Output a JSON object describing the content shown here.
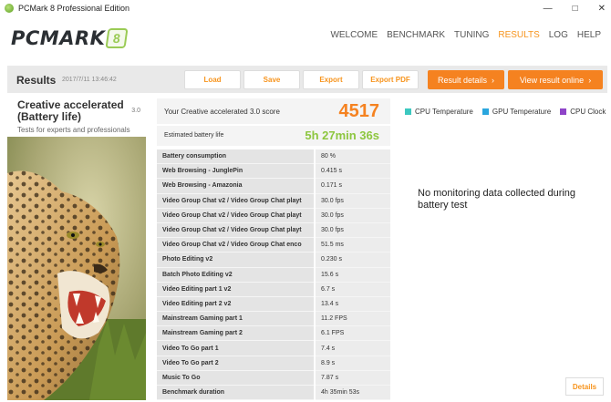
{
  "window": {
    "title": "PCMark 8 Professional Edition",
    "controls": [
      "—",
      "□",
      "✕"
    ]
  },
  "logo": {
    "text": "PCMARK",
    "badge": "8"
  },
  "nav": [
    {
      "label": "WELCOME",
      "active": false
    },
    {
      "label": "BENCHMARK",
      "active": false
    },
    {
      "label": "TUNING",
      "active": false
    },
    {
      "label": "RESULTS",
      "active": true
    },
    {
      "label": "LOG",
      "active": false
    },
    {
      "label": "HELP",
      "active": false
    }
  ],
  "toolbar": {
    "title": "Results",
    "date": "2017/7/11 13:46:42",
    "load_label": "Load",
    "save_label": "Save",
    "export_label": "Export",
    "export_pdf_label": "Export PDF",
    "result_details_label": "Result details",
    "view_online_label": "View result online",
    "chevron": "›"
  },
  "test": {
    "name": "Creative accelerated (Battery life)",
    "version": "3.0",
    "subtitle": "Tests for experts and professionals"
  },
  "score": {
    "label": "Your Creative accelerated 3.0 score",
    "value": "4517"
  },
  "battery": {
    "label": "Estimated battery life",
    "value": "5h 27min 36s"
  },
  "results": [
    {
      "name": "Battery consumption",
      "value": "80 %"
    },
    {
      "name": "Web Browsing - JunglePin",
      "value": "0.415 s"
    },
    {
      "name": "Web Browsing - Amazonia",
      "value": "0.171 s"
    },
    {
      "name": "Video Group Chat v2 / Video Group Chat playt",
      "value": "30.0 fps"
    },
    {
      "name": "Video Group Chat v2 / Video Group Chat playt",
      "value": "30.0 fps"
    },
    {
      "name": "Video Group Chat v2 / Video Group Chat playt",
      "value": "30.0 fps"
    },
    {
      "name": "Video Group Chat v2 / Video Group Chat enco",
      "value": "51.5 ms"
    },
    {
      "name": "Photo Editing v2",
      "value": "0.230 s"
    },
    {
      "name": "Batch Photo Editing v2",
      "value": "15.6 s"
    },
    {
      "name": "Video Editing part 1 v2",
      "value": "6.7 s"
    },
    {
      "name": "Video Editing part 2 v2",
      "value": "13.4 s"
    },
    {
      "name": "Mainstream Gaming part 1",
      "value": "11.2 FPS"
    },
    {
      "name": "Mainstream Gaming part 2",
      "value": "6.1 FPS"
    },
    {
      "name": "Video To Go part 1",
      "value": "7.4 s"
    },
    {
      "name": "Video To Go part 2",
      "value": "8.9 s"
    },
    {
      "name": "Music To Go",
      "value": "7.87 s"
    },
    {
      "name": "Benchmark duration",
      "value": "4h 35min 53s"
    }
  ],
  "monitoring": {
    "legend": [
      {
        "label": "CPU Temperature",
        "color": "#3cc8c0"
      },
      {
        "label": "GPU Temperature",
        "color": "#2aa6de"
      },
      {
        "label": "CPU Clock",
        "color": "#8e44c8"
      }
    ],
    "message": "No monitoring data collected during battery test",
    "details_label": "Details"
  },
  "colors": {
    "accent": "#f58220",
    "battery_green": "#8dc63f"
  }
}
